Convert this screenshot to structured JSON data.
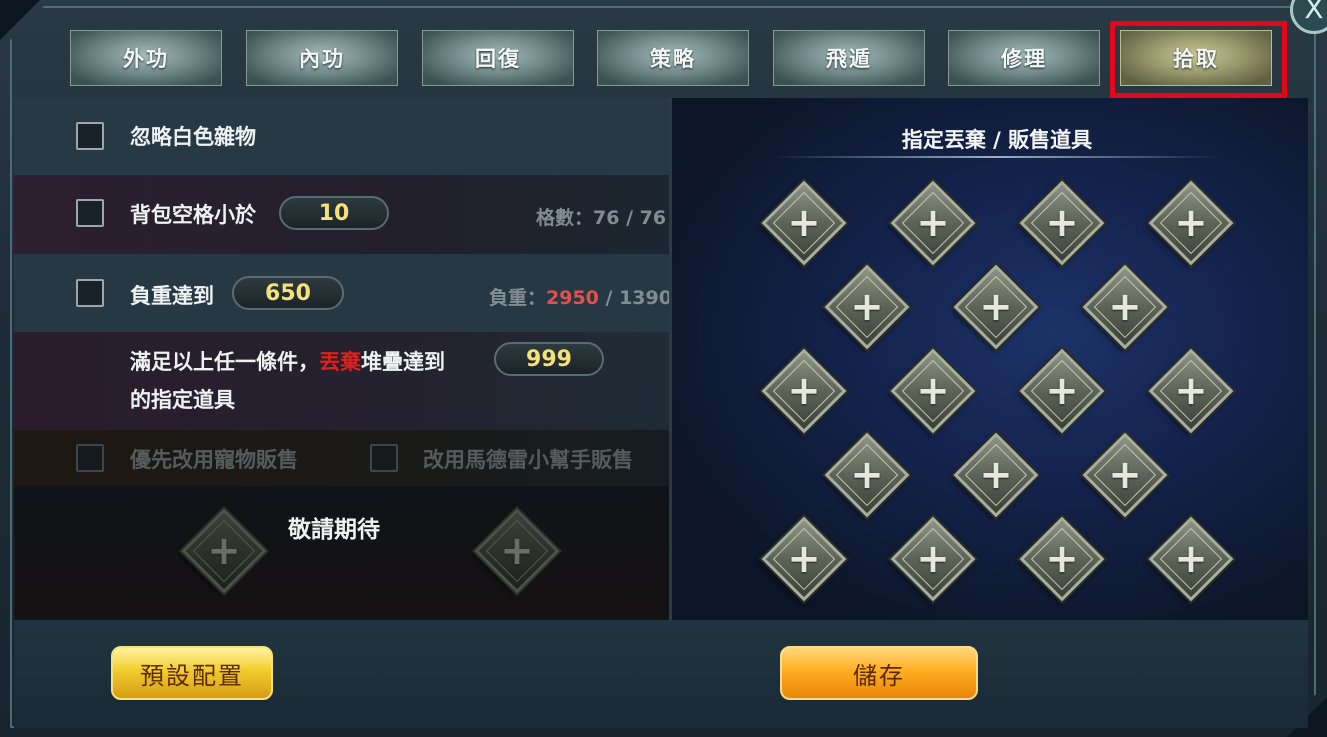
{
  "close_glyph": "X",
  "tabs": [
    {
      "label": "外功",
      "active": false
    },
    {
      "label": "內功",
      "active": false
    },
    {
      "label": "回復",
      "active": false
    },
    {
      "label": "策略",
      "active": false
    },
    {
      "label": "飛遁",
      "active": false
    },
    {
      "label": "修理",
      "active": false
    },
    {
      "label": "拾取",
      "active": true
    }
  ],
  "left": {
    "ignore_white": {
      "label": "忽略白色雜物",
      "checked": false
    },
    "bag_space": {
      "label": "背包空格小於",
      "value": "10",
      "info_label": "格數：",
      "info_current": "76",
      "info_sep": " / ",
      "info_max": "76",
      "checked": false
    },
    "weight": {
      "label": "負重達到",
      "value": "650",
      "info_label": "負重：",
      "info_current": "2950",
      "info_sep": " / ",
      "info_max": "1390",
      "checked": false
    },
    "condition": {
      "prefix": "滿足以上任一條件，",
      "highlight": "丟棄",
      "suffix": "堆疊達到",
      "value": "999",
      "line2": "的指定道具"
    },
    "pet_sell": {
      "label": "優先改用寵物販售",
      "checked": false
    },
    "helper_sell": {
      "label": "改用馬德雷小幫手販售",
      "checked": false
    },
    "coming_soon": "敬請期待"
  },
  "right": {
    "title": "指定丟棄 / 販售道具",
    "slot_icon": "+"
  },
  "buttons": {
    "default_config": "預設配置",
    "save": "儲存"
  },
  "colors": {
    "highlight_red": "#e0201c",
    "value_yellow": "#f4e277",
    "weight_over_red": "#e2504e"
  }
}
